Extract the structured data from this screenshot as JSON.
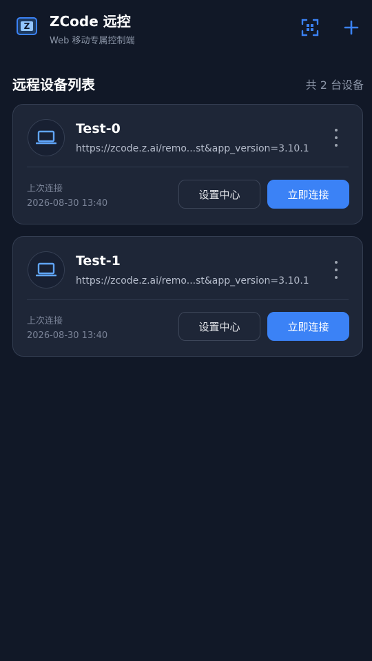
{
  "header": {
    "title": "ZCode 远控",
    "subtitle": "Web 移动专属控制端",
    "logo_icon": "zcode-logo-icon",
    "scan_icon": "scan-icon",
    "add_icon": "plus-icon"
  },
  "section": {
    "title": "远程设备列表",
    "count_text": "共 2 台设备"
  },
  "devices": [
    {
      "name": "Test-0",
      "url": "https://zcode.z.ai/remo...st&app_version=3.10.1",
      "last_label": "上次连接",
      "last_time": "2026-08-30 13:40",
      "settings_label": "设置中心",
      "connect_label": "立即连接"
    },
    {
      "name": "Test-1",
      "url": "https://zcode.z.ai/remo...st&app_version=3.10.1",
      "last_label": "上次连接",
      "last_time": "2026-08-30 13:40",
      "settings_label": "设置中心",
      "connect_label": "立即连接"
    }
  ],
  "colors": {
    "background": "#111827",
    "card": "#1e2637",
    "accent": "#3b82f6",
    "muted_text": "#7a8397"
  }
}
